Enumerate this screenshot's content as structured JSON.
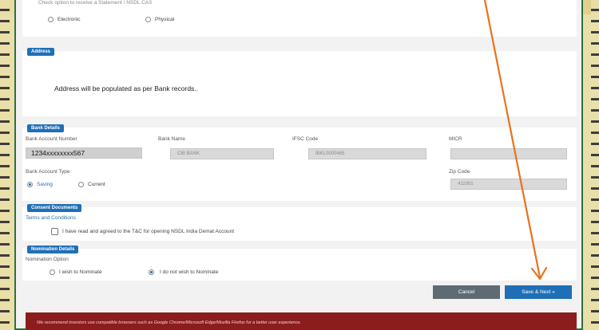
{
  "statement_option": {
    "question": "Check option to receive a Statement / NSDL CAS",
    "options": [
      {
        "label": "Electronic",
        "selected": false
      },
      {
        "label": "Physical",
        "selected": false
      }
    ]
  },
  "address": {
    "tag": "Address",
    "text": "Address will be populated as per Bank records.."
  },
  "bank_details": {
    "tag": "Bank Details",
    "account_number_label": "Bank Account Number",
    "account_number_value": "1234xxxxxxxx567",
    "bank_name_label": "Bank Name",
    "bank_name_value": "CBI BANK",
    "ifsc_label": "IFSC Code",
    "ifsc_value": "IBKL0000465",
    "micr_label": "MICR",
    "micr_value": "",
    "account_type_label": "Bank Account Type",
    "account_types": [
      {
        "label": "Saving",
        "selected": true
      },
      {
        "label": "Current",
        "selected": false
      }
    ],
    "zip_label": "Zip Code",
    "zip_value": "411001"
  },
  "consent": {
    "tag": "Consent Documents",
    "link": "Terms and Conditions",
    "checkbox_label": "I have read and agreed to the T&C for opening NSDL India Demat Account",
    "checked": false
  },
  "nomination": {
    "tag": "Nomination Details",
    "option_label": "Nomination Option",
    "options": [
      {
        "label": "I wish to Nominate",
        "selected": false
      },
      {
        "label": "I do not wish to Nominate",
        "selected": true
      }
    ]
  },
  "actions": {
    "cancel_label": "Cancel",
    "next_label": "Save & Next »"
  },
  "footer": {
    "text": "We recommend investors use compatible browsers such as Google Chrome/Microsoft Edge/Mozilla Firefox for a better user experience."
  },
  "colors": {
    "accent": "#1f6fb6",
    "annotation_arrow": "#e8731c",
    "footer_bg": "#8b1d1d",
    "frame_border": "#2e6f3e",
    "cancel_bg": "#5f6b73"
  },
  "icons": {
    "annotation": "arrow-icon"
  }
}
